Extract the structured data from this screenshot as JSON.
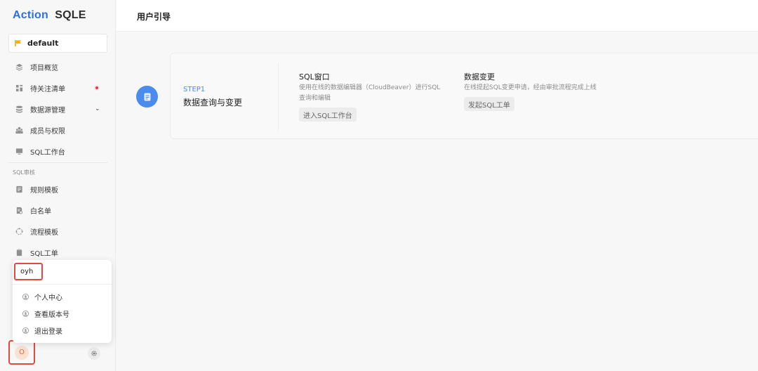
{
  "app": {
    "logo_action": "Action",
    "logo_rest": "SQLE"
  },
  "sidebar": {
    "project": "default",
    "items": [
      {
        "label": "项目概览",
        "icon": "overview-icon"
      },
      {
        "label": "待关注清单",
        "icon": "todo-list-icon",
        "has_dot": true
      },
      {
        "label": "数据源管理",
        "icon": "database-icon",
        "has_chevron": true
      },
      {
        "label": "成员与权限",
        "icon": "members-icon"
      },
      {
        "label": "SQL工作台",
        "icon": "monitor-icon"
      }
    ],
    "section_label": "SQL审核",
    "section_items": [
      {
        "label": "规则模板",
        "icon": "rule-template-icon"
      },
      {
        "label": "白名单",
        "icon": "whitelist-icon"
      },
      {
        "label": "流程模板",
        "icon": "workflow-icon"
      },
      {
        "label": "SQL工单",
        "icon": "ticket-icon"
      }
    ]
  },
  "user_menu": {
    "username": "oyh",
    "items": [
      "个人中心",
      "查看版本号",
      "退出登录"
    ]
  },
  "avatar": {
    "initial": "O"
  },
  "main": {
    "title": "用户引导",
    "step": {
      "label": "STEP1",
      "title": "数据查询与变更",
      "actions": [
        {
          "title": "SQL窗口",
          "desc": "使用在线的数据编辑器（CloudBeaver）进行SQL查询和编辑",
          "button": "进入SQL工作台"
        },
        {
          "title": "数据变更",
          "desc": "在线提起SQL变更申请，经由审批流程完成上线",
          "button": "发起SQL工单"
        }
      ]
    }
  },
  "colors": {
    "brand": "#2b6fe0",
    "step_blue": "#4a8bee",
    "highlight_red": "#e04b3f",
    "badge_red": "#e8344e"
  }
}
